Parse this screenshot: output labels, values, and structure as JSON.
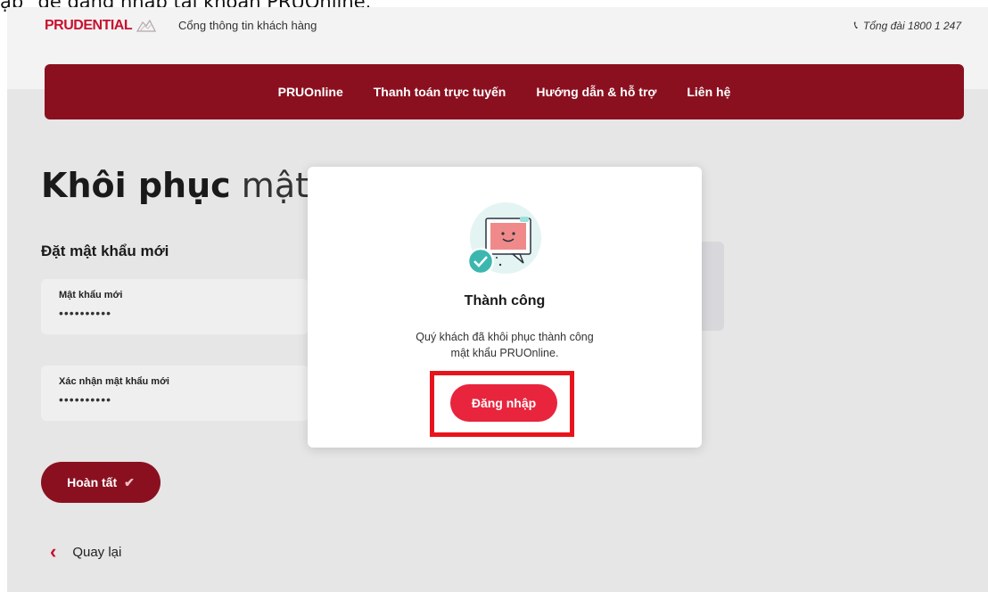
{
  "caption": "ập\" để đăng nhập tài khoản PRUOnline.",
  "header": {
    "brand": "PRUDENTIAL",
    "portal": "Cổng thông tin khách hàng",
    "hotline": "Tổng đài 1800 1 247"
  },
  "nav": {
    "items": [
      {
        "label": "PRUOnline"
      },
      {
        "label": "Thanh toán trực tuyến"
      },
      {
        "label": "Hướng dẫn & hỗ trợ"
      },
      {
        "label": "Liên hệ"
      }
    ]
  },
  "page": {
    "title_bold": "Khôi phục",
    "title_light": "mật",
    "section_title": "Đặt mật khẩu mới",
    "new_password": {
      "label": "Mật khẩu mới",
      "value": "••••••••••"
    },
    "confirm_password": {
      "label": "Xác nhận mật khẩu mới",
      "value": "••••••••••"
    },
    "done_label": "Hoàn tất",
    "back_label": "Quay lại"
  },
  "modal": {
    "title": "Thành công",
    "message_line1": "Quý khách đã khôi phục thành công",
    "message_line2": "mật khẩu PRUOnline.",
    "login_label": "Đăng nhập"
  },
  "colors": {
    "brand_red": "#c8102e",
    "nav_red": "#8a1020",
    "button_red": "#e8253d",
    "highlight": "#e8141c",
    "success_teal": "#3bb7b0"
  }
}
